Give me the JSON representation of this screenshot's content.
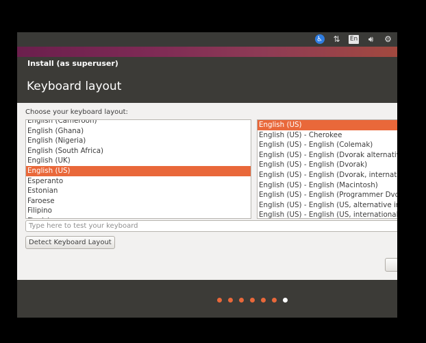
{
  "top_panel": {
    "icons": [
      "accessibility-icon",
      "network-icon",
      "keyboard-indicator",
      "volume-icon",
      "settings-icon"
    ],
    "keyboard_indicator": "En"
  },
  "window": {
    "title": "Install (as superuser)"
  },
  "page": {
    "title": "Keyboard layout"
  },
  "layout_section": {
    "label": "Choose your keyboard layout:",
    "layouts": [
      "English (Cameroon)",
      "English (Ghana)",
      "English (Nigeria)",
      "English (South Africa)",
      "English (UK)",
      "English (US)",
      "Esperanto",
      "Estonian",
      "Faroese",
      "Filipino",
      "Finnish"
    ],
    "selected_layout": "English (US)",
    "variants": [
      "English (US)",
      "English (US) - Cherokee",
      "English (US) - English (Colemak)",
      "English (US) - English (Dvorak alternative international no dead keys)",
      "English (US) - English (Dvorak)",
      "English (US) - English (Dvorak, international with dead keys)",
      "English (US) - English (Macintosh)",
      "English (US) - English (Programmer Dvorak)",
      "English (US) - English (US, alternative international)",
      "English (US) - English (US, international with dead keys)"
    ],
    "selected_variant": "English (US)"
  },
  "test_field": {
    "placeholder": "Type here to test your keyboard",
    "value": ""
  },
  "detect_button": {
    "label": "Detect Keyboard Layout"
  },
  "progress": {
    "total_steps": 7,
    "current_step": 7
  },
  "colors": {
    "accent": "#e9683a",
    "background_dark": "#3c3b37",
    "content_bg": "#f2f1f0"
  }
}
